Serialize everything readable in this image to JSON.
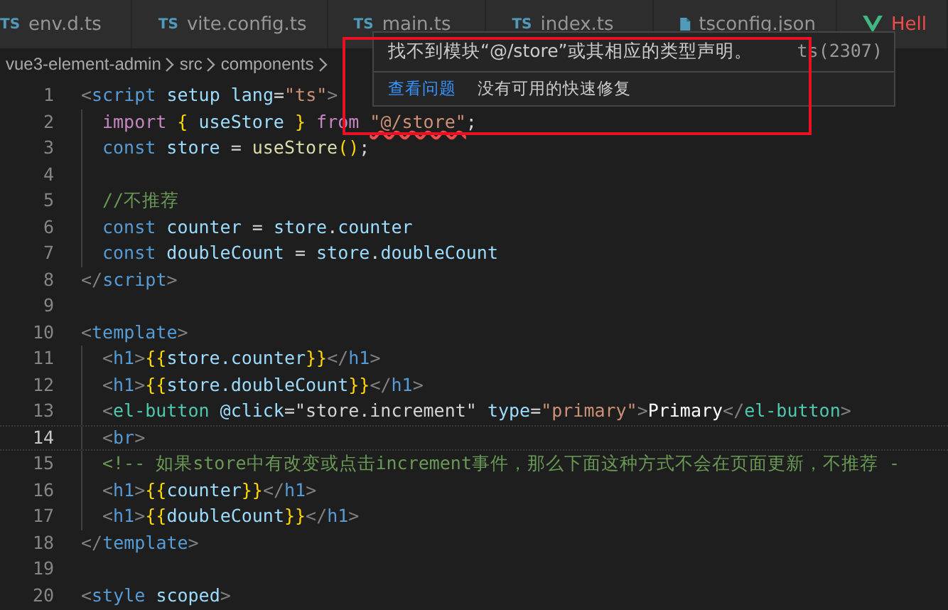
{
  "tabs": [
    {
      "label": "env.d.ts",
      "kind": "ts",
      "icon_text": "TS",
      "selected": false
    },
    {
      "label": "vite.config.ts",
      "kind": "ts",
      "icon_text": "TS",
      "selected": false
    },
    {
      "label": "main.ts",
      "kind": "ts",
      "icon_text": "TS",
      "selected": false
    },
    {
      "label": "index.ts",
      "kind": "ts",
      "icon_text": "TS",
      "selected": false
    },
    {
      "label": "tsconfig.json",
      "kind": "config",
      "selected": false
    },
    {
      "label": "Hell",
      "kind": "vue",
      "selected": false
    }
  ],
  "breadcrumb": [
    "vue3-element-admin",
    "src",
    "components"
  ],
  "editor": {
    "lines": [
      {
        "number": "1",
        "current": false,
        "indented": false,
        "tokens": [
          {
            "kind": "punct",
            "text": "<"
          },
          {
            "kind": "tag",
            "text": "script"
          },
          {
            "kind": "attr",
            "text": " setup lang"
          },
          {
            "kind": "plain",
            "text": "="
          },
          {
            "kind": "string",
            "text": "\"ts\""
          },
          {
            "kind": "punct",
            "text": ">"
          }
        ]
      },
      {
        "number": "2",
        "current": false,
        "indented": true,
        "tokens": [
          {
            "kind": "keyword",
            "text": "import"
          },
          {
            "kind": "brace",
            "text": " {"
          },
          {
            "kind": "var",
            "text": " useStore "
          },
          {
            "kind": "brace",
            "text": "}"
          },
          {
            "kind": "keyword",
            "text": " from "
          },
          {
            "kind": "string",
            "text": "\"@/store\"",
            "error": true
          },
          {
            "kind": "plain",
            "text": ";"
          }
        ]
      },
      {
        "number": "3",
        "current": false,
        "indented": true,
        "tokens": [
          {
            "kind": "storage",
            "text": "const"
          },
          {
            "kind": "var",
            "text": " store"
          },
          {
            "kind": "plain",
            "text": " = "
          },
          {
            "kind": "func",
            "text": "useStore"
          },
          {
            "kind": "brace",
            "text": "()"
          },
          {
            "kind": "plain",
            "text": ";"
          }
        ]
      },
      {
        "number": "4",
        "current": false,
        "indented": true
      },
      {
        "number": "5",
        "current": false,
        "indented": true,
        "tokens": [
          {
            "kind": "comment",
            "text": "//不推荐"
          }
        ]
      },
      {
        "number": "6",
        "current": false,
        "indented": true,
        "tokens": [
          {
            "kind": "storage",
            "text": "const"
          },
          {
            "kind": "var",
            "text": " counter"
          },
          {
            "kind": "plain",
            "text": " = "
          },
          {
            "kind": "var",
            "text": "store"
          },
          {
            "kind": "plain",
            "text": "."
          },
          {
            "kind": "var",
            "text": "counter"
          }
        ]
      },
      {
        "number": "7",
        "current": false,
        "indented": true,
        "tokens": [
          {
            "kind": "storage",
            "text": "const"
          },
          {
            "kind": "var",
            "text": " doubleCount"
          },
          {
            "kind": "plain",
            "text": " = "
          },
          {
            "kind": "var",
            "text": "store"
          },
          {
            "kind": "plain",
            "text": "."
          },
          {
            "kind": "var",
            "text": "doubleCount"
          }
        ]
      },
      {
        "number": "8",
        "current": false,
        "indented": false,
        "tokens": [
          {
            "kind": "punct",
            "text": "</"
          },
          {
            "kind": "tag",
            "text": "script"
          },
          {
            "kind": "punct",
            "text": ">"
          }
        ]
      },
      {
        "number": "9",
        "current": false,
        "indented": false
      },
      {
        "number": "10",
        "current": false,
        "indented": false,
        "tokens": [
          {
            "kind": "punct",
            "text": "<"
          },
          {
            "kind": "tag",
            "text": "template"
          },
          {
            "kind": "punct",
            "text": ">"
          }
        ]
      },
      {
        "number": "11",
        "current": false,
        "indented": true,
        "tokens": [
          {
            "kind": "punct",
            "text": "<"
          },
          {
            "kind": "tag",
            "text": "h1"
          },
          {
            "kind": "punct",
            "text": ">"
          },
          {
            "kind": "brace",
            "text": "{{"
          },
          {
            "kind": "var",
            "text": "store.counter"
          },
          {
            "kind": "brace",
            "text": "}}"
          },
          {
            "kind": "punct",
            "text": "</"
          },
          {
            "kind": "tag",
            "text": "h1"
          },
          {
            "kind": "punct",
            "text": ">"
          }
        ]
      },
      {
        "number": "12",
        "current": false,
        "indented": true,
        "tokens": [
          {
            "kind": "punct",
            "text": "<"
          },
          {
            "kind": "tag",
            "text": "h1"
          },
          {
            "kind": "punct",
            "text": ">"
          },
          {
            "kind": "brace",
            "text": "{{"
          },
          {
            "kind": "var",
            "text": "store.doubleCount"
          },
          {
            "kind": "brace",
            "text": "}}"
          },
          {
            "kind": "punct",
            "text": "</"
          },
          {
            "kind": "tag",
            "text": "h1"
          },
          {
            "kind": "punct",
            "text": ">"
          }
        ]
      },
      {
        "number": "13",
        "current": false,
        "indented": true,
        "tokens": [
          {
            "kind": "punct",
            "text": "<"
          },
          {
            "kind": "component",
            "text": "el-button"
          },
          {
            "kind": "attr",
            "text": " @click"
          },
          {
            "kind": "plain",
            "text": "=\"store.increment\""
          },
          {
            "kind": "attr",
            "text": " type"
          },
          {
            "kind": "plain",
            "text": "="
          },
          {
            "kind": "string",
            "text": "\"primary\""
          },
          {
            "kind": "punct",
            "text": ">"
          },
          {
            "kind": "bright",
            "text": "Primary"
          },
          {
            "kind": "punct",
            "text": "</"
          },
          {
            "kind": "component",
            "text": "el-button"
          },
          {
            "kind": "punct",
            "text": ">"
          }
        ]
      },
      {
        "number": "14",
        "current": true,
        "indented": true,
        "tokens": [
          {
            "kind": "punct",
            "text": "<"
          },
          {
            "kind": "tag",
            "text": "br"
          },
          {
            "kind": "punct",
            "text": ">"
          }
        ]
      },
      {
        "number": "15",
        "current": false,
        "indented": true,
        "tokens": [
          {
            "kind": "comment",
            "text": "<!-- 如果store中有改变或点击increment事件，那么下面这种方式不会在页面更新，不推荐 -"
          }
        ]
      },
      {
        "number": "16",
        "current": false,
        "indented": true,
        "tokens": [
          {
            "kind": "punct",
            "text": "<"
          },
          {
            "kind": "tag",
            "text": "h1"
          },
          {
            "kind": "punct",
            "text": ">"
          },
          {
            "kind": "brace",
            "text": "{{"
          },
          {
            "kind": "var",
            "text": "counter"
          },
          {
            "kind": "brace",
            "text": "}}"
          },
          {
            "kind": "punct",
            "text": "</"
          },
          {
            "kind": "tag",
            "text": "h1"
          },
          {
            "kind": "punct",
            "text": ">"
          }
        ]
      },
      {
        "number": "17",
        "current": false,
        "indented": true,
        "tokens": [
          {
            "kind": "punct",
            "text": "<"
          },
          {
            "kind": "tag",
            "text": "h1"
          },
          {
            "kind": "punct",
            "text": ">"
          },
          {
            "kind": "brace",
            "text": "{{"
          },
          {
            "kind": "var",
            "text": "doubleCount"
          },
          {
            "kind": "brace",
            "text": "}}"
          },
          {
            "kind": "punct",
            "text": "</"
          },
          {
            "kind": "tag",
            "text": "h1"
          },
          {
            "kind": "punct",
            "text": ">"
          }
        ]
      },
      {
        "number": "18",
        "current": false,
        "indented": false,
        "tokens": [
          {
            "kind": "punct",
            "text": "</"
          },
          {
            "kind": "tag",
            "text": "template"
          },
          {
            "kind": "punct",
            "text": ">"
          }
        ]
      },
      {
        "number": "19",
        "current": false,
        "indented": false
      },
      {
        "number": "20",
        "current": false,
        "indented": false,
        "tokens": [
          {
            "kind": "punct",
            "text": "<"
          },
          {
            "kind": "tag",
            "text": "style"
          },
          {
            "kind": "attr",
            "text": " scoped"
          },
          {
            "kind": "punct",
            "text": ">"
          }
        ]
      }
    ]
  },
  "hover": {
    "message": "找不到模块“@/store”或其相应的类型声明。",
    "code": "ts(2307)",
    "actions": [
      "查看问题",
      "没有可用的快速修复"
    ]
  }
}
